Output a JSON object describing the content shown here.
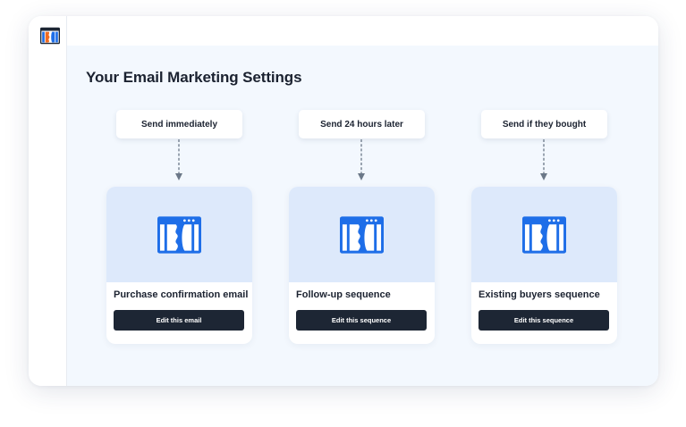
{
  "app": {
    "logo_icon": "clickfunnels-logo-icon",
    "brand_color": "#1e6ee8",
    "dark_color": "#1d2634",
    "media_background": "#dde9fb"
  },
  "page": {
    "title": "Your Email Marketing Settings"
  },
  "columns": [
    {
      "trigger_label": "Send immediately",
      "card_title": "Purchase confirmation email",
      "button_label": "Edit this email"
    },
    {
      "trigger_label": "Send 24 hours later",
      "card_title": "Follow-up sequence",
      "button_label": "Edit this sequence"
    },
    {
      "trigger_label": "Send if they bought",
      "card_title": "Existing buyers sequence",
      "button_label": "Edit this sequence"
    }
  ]
}
